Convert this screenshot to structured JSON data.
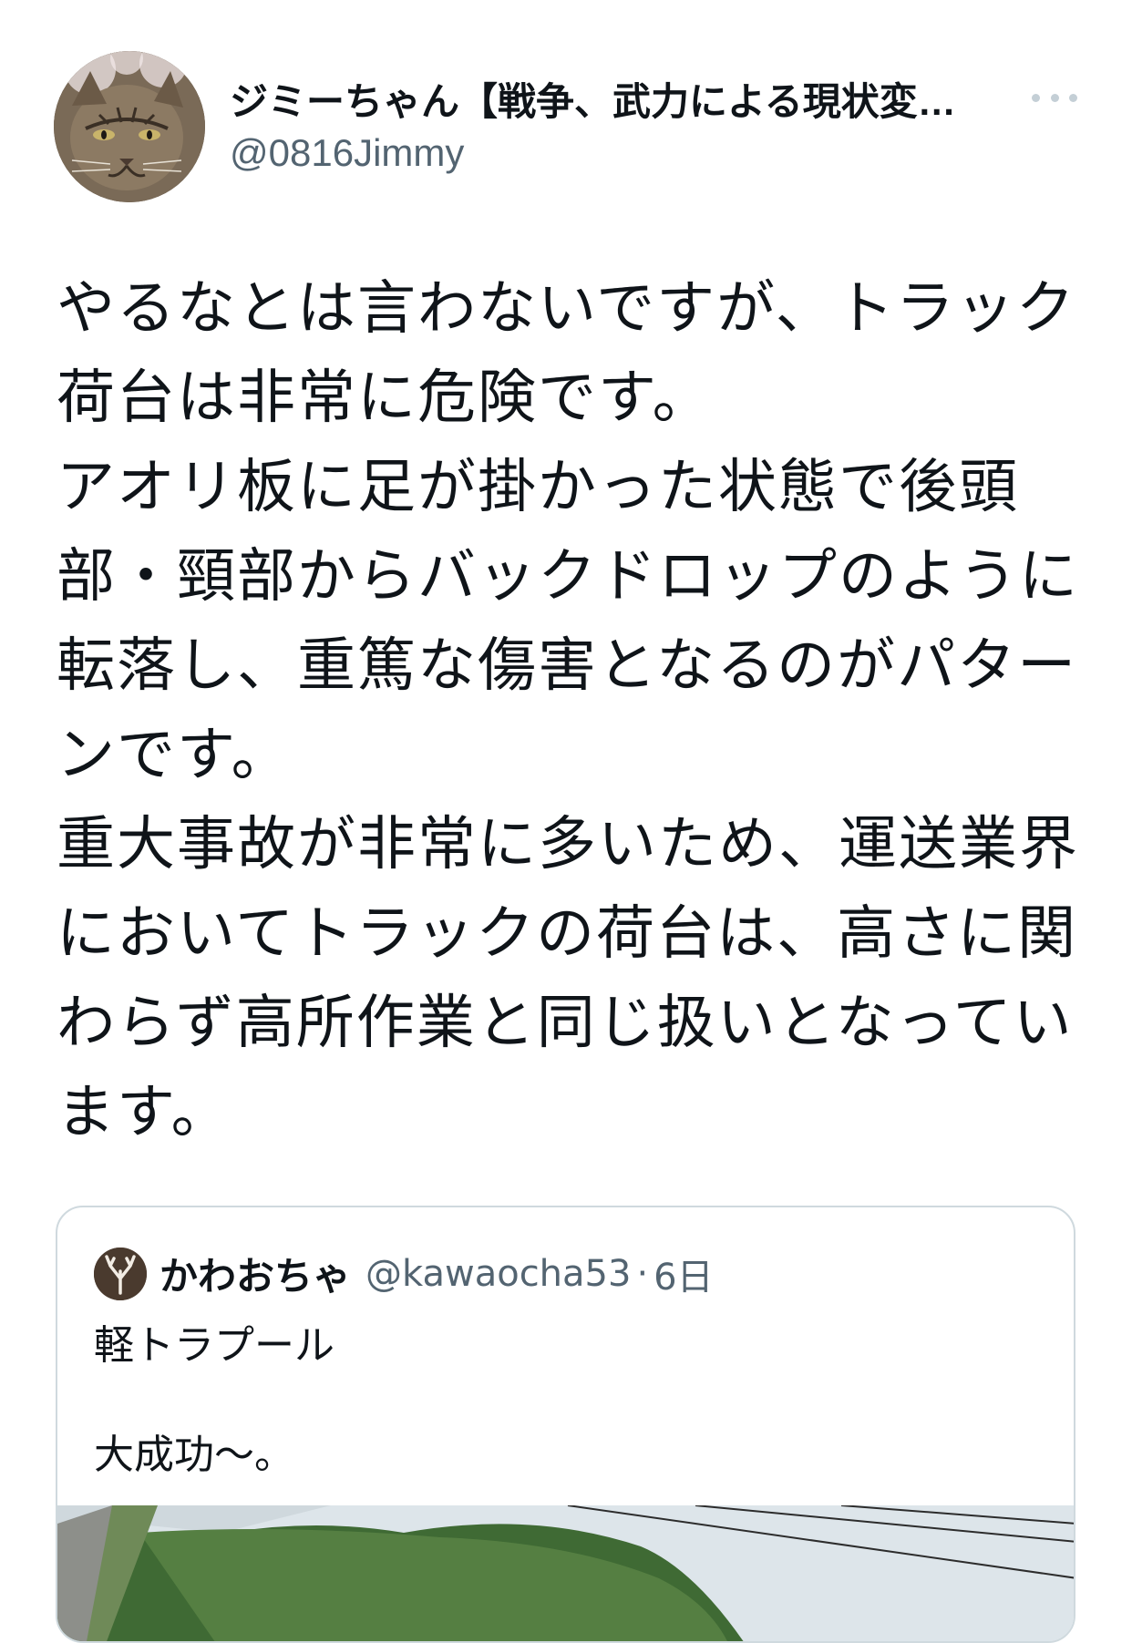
{
  "author": {
    "display_name": "ジミーちゃん【戦争、武力による現状変…",
    "handle": "@0816Jimmy"
  },
  "tweet": {
    "lines": [
      "やるなとは言わないですが、トラック",
      "荷台は非常に危険です。",
      "アオリ板に足が掛かった状態で後頭",
      "部・頸部からバックドロップのように",
      "転落し、重篤な傷害となるのがパター",
      "ンです。",
      "重大事故が非常に多いため、運送業界",
      "においてトラックの荷台は、高さに関",
      "わらず高所作業と同じ扱いとなってい",
      "ます。"
    ]
  },
  "quote": {
    "display_name": "かわおちゃ",
    "handle": "@kawaocha53",
    "separator": "·",
    "time": "6日",
    "lines": [
      "軽トラプール",
      "",
      "大成功〜。"
    ]
  },
  "icons": {
    "avatar": "cat-avatar",
    "quote_avatar": "antler-logo-avatar",
    "more": "more-dots-icon"
  },
  "colors": {
    "text": "#0f1419",
    "secondary": "#536471",
    "border": "#cfd9de"
  }
}
